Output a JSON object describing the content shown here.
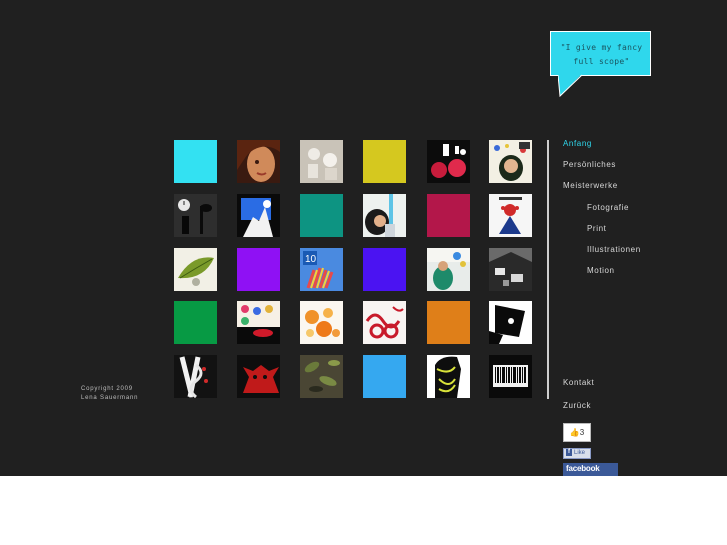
{
  "speech_bubble": {
    "quote_line1": "\"I give my fancy",
    "quote_line2": "full scope\""
  },
  "colors": {
    "background": "#202020",
    "accent": "#2fd7ec",
    "nav_text": "#d8d8d8"
  },
  "gallery": {
    "tiles": [
      {
        "kind": "solid",
        "color": "#33e1f2"
      },
      {
        "kind": "image",
        "icon": "face-portrait-image"
      },
      {
        "kind": "image",
        "icon": "paper-figures-image"
      },
      {
        "kind": "solid",
        "color": "#d5c81f"
      },
      {
        "kind": "image",
        "icon": "red-collage-image"
      },
      {
        "kind": "image",
        "icon": "girl-stars-illustration"
      },
      {
        "kind": "image",
        "icon": "clock-silhouette-image"
      },
      {
        "kind": "image",
        "icon": "blue-hands-image"
      },
      {
        "kind": "solid",
        "color": "#0d9482"
      },
      {
        "kind": "image",
        "icon": "girl-painting-image"
      },
      {
        "kind": "solid",
        "color": "#b3174a"
      },
      {
        "kind": "image",
        "icon": "poster-figure-image"
      },
      {
        "kind": "image",
        "icon": "leaf-illustration"
      },
      {
        "kind": "solid",
        "color": "#8f11f4"
      },
      {
        "kind": "image",
        "icon": "hands-poster-image"
      },
      {
        "kind": "solid",
        "color": "#4b13f2"
      },
      {
        "kind": "image",
        "icon": "workshop-photo-image"
      },
      {
        "kind": "image",
        "icon": "table-photo-image"
      },
      {
        "kind": "solid",
        "color": "#079a44"
      },
      {
        "kind": "image",
        "icon": "lips-pattern-image"
      },
      {
        "kind": "image",
        "icon": "orange-dots-image"
      },
      {
        "kind": "image",
        "icon": "red-ornament-image"
      },
      {
        "kind": "solid",
        "color": "#df7f19"
      },
      {
        "kind": "image",
        "icon": "black-shape-image"
      },
      {
        "kind": "image",
        "icon": "dna-figure-image"
      },
      {
        "kind": "image",
        "icon": "red-bull-image"
      },
      {
        "kind": "image",
        "icon": "leaves-photo-image"
      },
      {
        "kind": "solid",
        "color": "#35a8f0"
      },
      {
        "kind": "image",
        "icon": "yellow-tangle-image"
      },
      {
        "kind": "image",
        "icon": "barcode-image"
      }
    ]
  },
  "nav": {
    "anfang": "Anfang",
    "persoenliches": "Persönliches",
    "meisterwerke": "Meisterwerke",
    "fotografie": "Fotografie",
    "print": "Print",
    "illustrationen": "Illustrationen",
    "motion": "Motion",
    "kontakt": "Kontakt",
    "zurueck": "Zurück"
  },
  "copyright": {
    "line1": "Copyright 2009",
    "line2": "Lena Sauermann"
  },
  "social": {
    "like_count": "3",
    "like_label": "Like",
    "facebook_label": "facebook"
  }
}
